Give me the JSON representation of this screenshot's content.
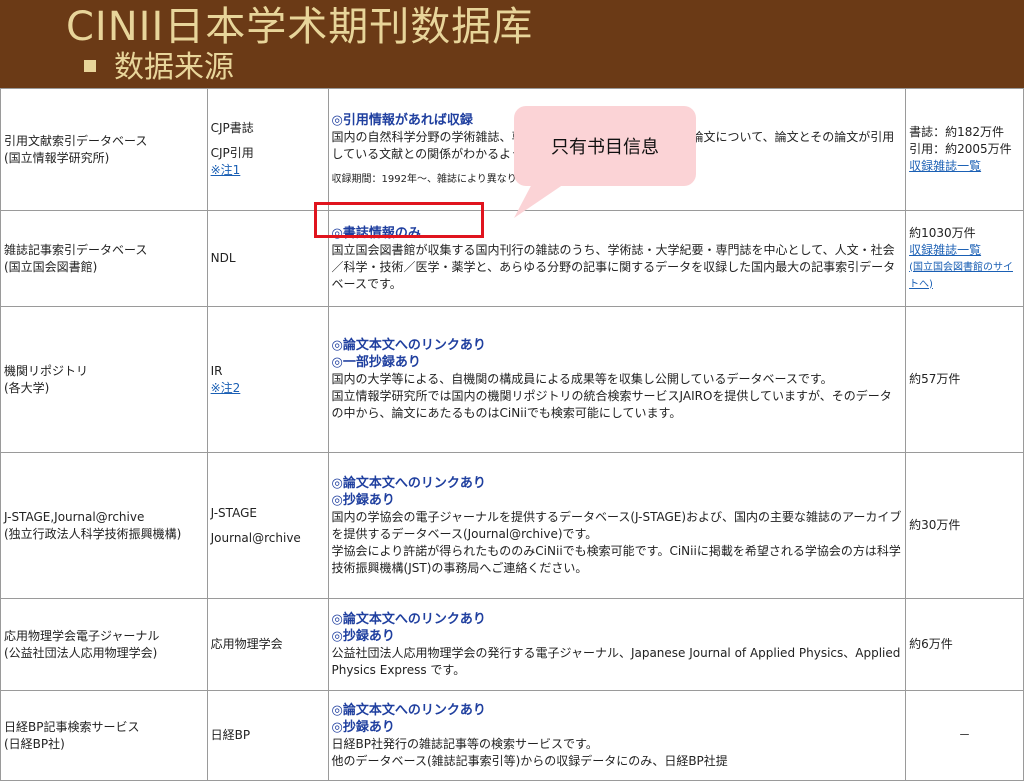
{
  "slide": {
    "title": "CINII日本学术期刊数据库",
    "subtitle": "数据来源"
  },
  "callout": {
    "text": "只有书目信息"
  },
  "rows": [
    {
      "name": "引用文献索引データベース",
      "org": "(国立情報学研究所)",
      "source1": "CJP書誌",
      "source2": "CJP引用",
      "note_link": "※注1",
      "headline1": "◎引用情報があれば収録",
      "desc": "国内の自然科学分野の学術雑誌、専門誌、大学紀要等に掲載された論文について、論文とその論文が引用している文献との関係がわかるように作られたデータベースです。",
      "period": "収録期間：1992年～、雑誌により異なります",
      "count1": "書誌：約182万件",
      "count2": "引用：約2005万件",
      "count_link": "収録雑誌一覧"
    },
    {
      "name": "雑誌記事索引データベース",
      "org": "(国立国会図書館)",
      "source1": "NDL",
      "headline1": "◎書誌情報のみ",
      "desc": "国立国会図書館が収集する国内刊行の雑誌のうち、学術誌・大学紀要・専門誌を中心として、人文・社会／科学・技術／医学・薬学と、あらゆる分野の記事に関するデータを収録した国内最大の記事索引データベースです。",
      "count1": "約1030万件",
      "count_link": "収録雑誌一覧",
      "count_link2": "(国立国会図書館のサイトへ)"
    },
    {
      "name": "機関リポジトリ",
      "org": "(各大学)",
      "source1": "IR",
      "note_link": "※注2",
      "headline1": "◎論文本文へのリンクあり",
      "headline2": "◎一部抄録あり",
      "desc": "国内の大学等による、自機関の構成員による成果等を収集し公開しているデータベースです。",
      "desc2": "国立情報学研究所では国内の機関リポジトリの統合検索サービスJAIROを提供していますが、そのデータの中から、論文にあたるものはCiNiiでも検索可能にしています。",
      "count1": "約57万件"
    },
    {
      "name": "J-STAGE,Journal@rchive",
      "org": "(独立行政法人科学技術振興機構)",
      "source1": "J-STAGE",
      "source2": "Journal@rchive",
      "headline1": "◎論文本文へのリンクあり",
      "headline2": "◎抄録あり",
      "desc": "国内の学協会の電子ジャーナルを提供するデータベース(J-STAGE)および、国内の主要な雑誌のアーカイブを提供するデータベース(Journal@rchive)です。",
      "desc2": "学協会により許諾が得られたもののみCiNiiでも検索可能です。CiNiiに掲載を希望される学協会の方は科学技術振興機構(JST)の事務局へご連絡ください。",
      "count1": "約30万件"
    },
    {
      "name": "応用物理学会電子ジャーナル",
      "org": "(公益社団法人応用物理学会)",
      "source1": "応用物理学会",
      "headline1": "◎論文本文へのリンクあり",
      "headline2": "◎抄録あり",
      "desc": "公益社団法人応用物理学会の発行する電子ジャーナル、Japanese Journal of Applied Physics、Applied Physics Express です。",
      "count1": "約6万件"
    },
    {
      "name": "日経BP記事検索サービス",
      "org": "(日経BP社)",
      "source1": "日経BP",
      "headline1": "◎論文本文へのリンクあり",
      "headline2": "◎抄録あり",
      "desc": "日経BP社発行の雑誌記事等の検索サービスです。",
      "desc2": "他のデータベース(雑誌記事索引等)からの収録データにのみ、日経BP社提",
      "count1": "－"
    }
  ]
}
